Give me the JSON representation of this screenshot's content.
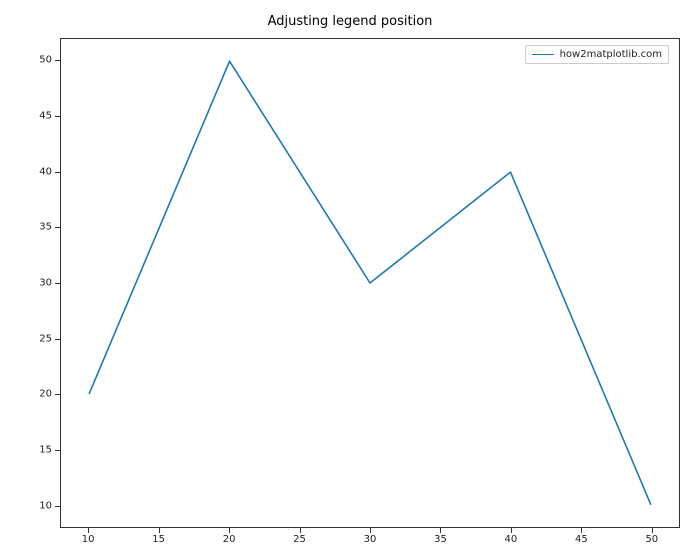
{
  "chart_data": {
    "type": "line",
    "title": "Adjusting legend position",
    "xlabel": "",
    "ylabel": "",
    "x": [
      10,
      20,
      30,
      40,
      50
    ],
    "series": [
      {
        "name": "how2matplotlib.com",
        "values": [
          20,
          50,
          30,
          40,
          10
        ]
      }
    ],
    "xlim": [
      8,
      52
    ],
    "ylim": [
      8,
      52
    ],
    "xticks": [
      10,
      15,
      20,
      25,
      30,
      35,
      40,
      45,
      50
    ],
    "yticks": [
      10,
      15,
      20,
      25,
      30,
      35,
      40,
      45,
      50
    ],
    "legend_position": "upper right",
    "line_color": "#1f77b4"
  }
}
